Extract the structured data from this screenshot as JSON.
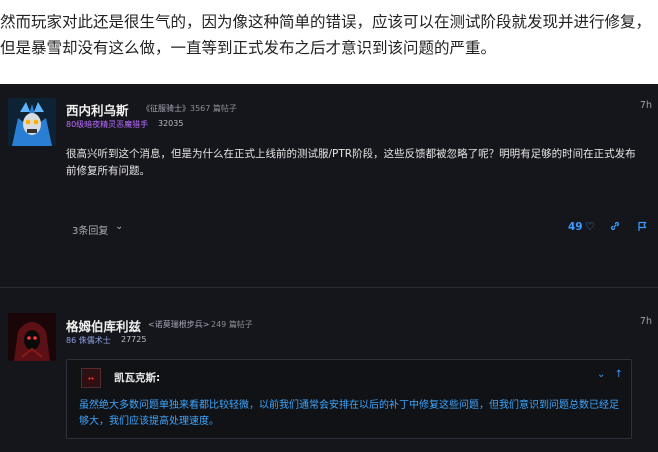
{
  "article": {
    "line1": "然而玩家对此还是很生气的，因为像这种简单的错误，应该可以在测试阶段就发现并进行修复，",
    "line2": "但是暴雪却没有这么做，一直等到正式发布之后才意识到该问题的严重。"
  },
  "posts": [
    {
      "username": "西内利乌斯",
      "title": "《征服骑士》",
      "post_count": "3567 篇帖子",
      "guild": "80级暗夜精灵恶魔猎手",
      "achievement": "32035",
      "time": "7h",
      "body": "很高兴听到这个消息，但是为什么在正式上线前的测试服/PTR阶段，这些反馈都被忽略了呢？明明有足够的时间在正式发布前修复所有问题。",
      "replies": "3条回复",
      "likes": "49"
    },
    {
      "username": "格姆伯库利兹",
      "title": "<诺莫瑞根步兵>",
      "post_count": "249 篇帖子",
      "guild": "86 侏儒术士",
      "achievement": "27725",
      "time": "7h",
      "quote": {
        "name": "凯瓦克斯:",
        "text": "虽然绝大多数问题单独来看都比较轻微，以前我们通常会安排在以后的补丁中修复这些问题，但我们意识到问题总数已经足够大，我们应该提高处理速度。"
      }
    }
  ],
  "icons": {
    "chevron": "chevron-down-icon",
    "heart": "heart-icon",
    "link": "link-icon",
    "flag": "flag-icon"
  },
  "colors": {
    "forum_bg": "#15161b",
    "accent": "#3e9bff",
    "guild_purple": "#b86bff"
  }
}
